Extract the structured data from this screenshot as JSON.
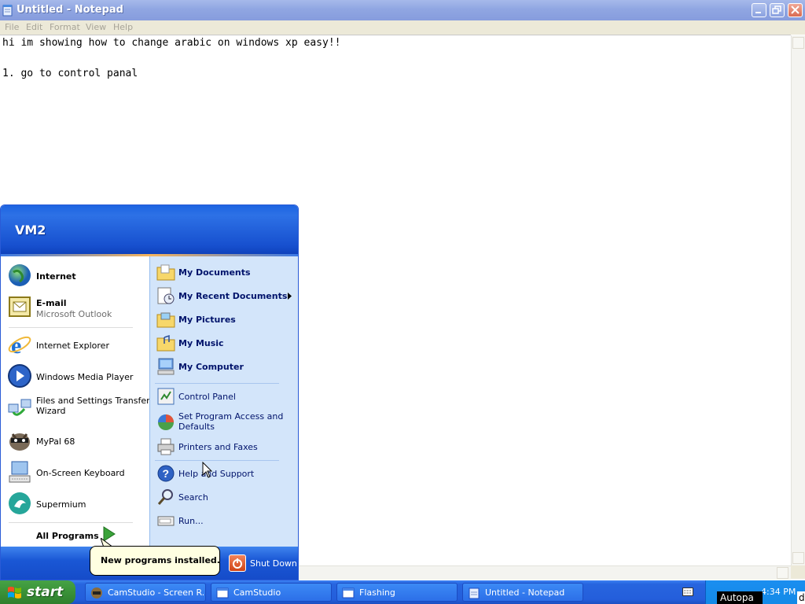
{
  "window": {
    "title": "Untitled - Notepad",
    "menu": [
      "File",
      "Edit",
      "Format",
      "View",
      "Help"
    ],
    "editor_lines": [
      "hi im showing how to change arabic on windows xp easy!!",
      "",
      "1. go to control panal"
    ]
  },
  "start_menu": {
    "user": "VM2",
    "left_pinned": [
      {
        "label": "Internet",
        "icon": "internet-globe-icon"
      },
      {
        "label": "E-mail",
        "sub": "Microsoft Outlook",
        "icon": "outlook-icon"
      }
    ],
    "left_recent": [
      {
        "label": "Internet Explorer",
        "icon": "internet-explorer-icon"
      },
      {
        "label": "Windows Media Player",
        "icon": "media-player-icon"
      },
      {
        "label": "Files and Settings Transfer",
        "label2": "Wizard",
        "icon": "transfer-wizard-icon"
      },
      {
        "label": "MyPal 68",
        "icon": "mypal-icon"
      },
      {
        "label": "On-Screen Keyboard",
        "icon": "keyboard-icon"
      },
      {
        "label": "Supermium",
        "icon": "supermium-icon"
      }
    ],
    "all_programs": "All Programs",
    "right_items": [
      {
        "label": "My Documents",
        "icon": "folder-icon"
      },
      {
        "label": "My Recent Documents",
        "icon": "recent-documents-icon"
      },
      {
        "label": "My Pictures",
        "icon": "folder-icon"
      },
      {
        "label": "My Music",
        "icon": "folder-icon"
      },
      {
        "label": "My Computer",
        "icon": "computer-icon"
      },
      {
        "label": "Control Panel",
        "icon": "control-panel-icon"
      },
      {
        "label": "Set Program Access and",
        "label2": "Defaults",
        "icon": "program-access-icon"
      },
      {
        "label": "Printers and Faxes",
        "icon": "printer-icon"
      },
      {
        "label": "Help and Support",
        "icon": "help-icon"
      },
      {
        "label": "Search",
        "icon": "search-icon"
      },
      {
        "label": "Run...",
        "icon": "run-icon"
      }
    ],
    "shutdown": "Shut Down",
    "balloon": "New programs installed."
  },
  "taskbar": {
    "start": "start",
    "tasks": [
      {
        "label": "CamStudio - Screen R...",
        "icon": "camstudio-icon"
      },
      {
        "label": "CamStudio",
        "icon": "window-icon"
      },
      {
        "label": "Flashing",
        "icon": "window-icon"
      },
      {
        "label": "Untitled - Notepad",
        "icon": "notepad-icon"
      }
    ],
    "clock": "4:34 PM",
    "overlay_text": "Autopa",
    "overlay_text2": "d"
  }
}
